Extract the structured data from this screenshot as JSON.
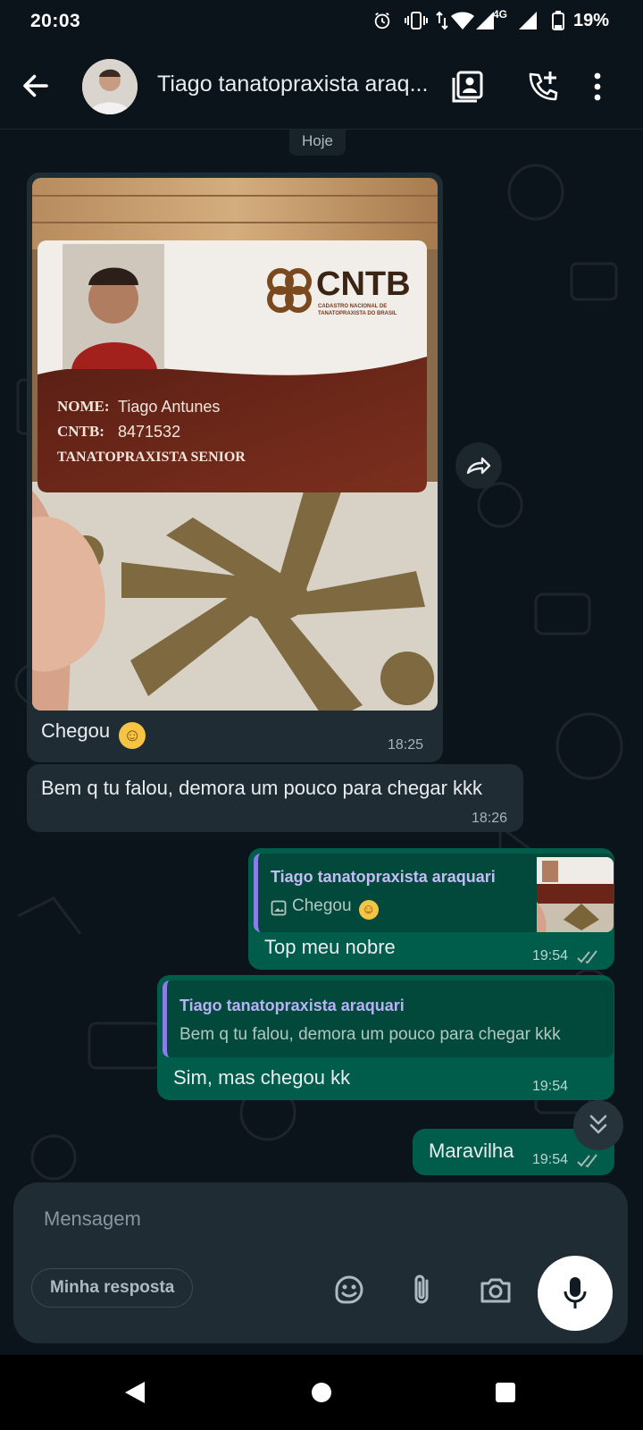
{
  "status_bar": {
    "time": "20:03",
    "network": "4G",
    "battery": "19%",
    "icons": [
      "alarm-icon",
      "vibrate-icon",
      "data-arrows-icon",
      "wifi-icon",
      "signal-icon",
      "signal-icon",
      "battery-icon"
    ]
  },
  "header": {
    "contact_name": "Tiago tanatopraxista araq...",
    "actions": [
      "contact-card-icon",
      "add-call-icon",
      "more-icon"
    ]
  },
  "chat": {
    "date_label": "Hoje",
    "card_photo": {
      "brand": "CNTB",
      "brand_sub": "CADASTRO NACIONAL DE TANATOPRAXISTA DO BRASIL",
      "name_label": "NOME:",
      "name_value": "Tiago Antunes",
      "id_label": "CNTB:",
      "id_value": "8471532",
      "role": "TANATOPRAXISTA SENIOR"
    },
    "messages": [
      {
        "direction": "in",
        "text": "Chegou",
        "emoji": "☺",
        "time": "18:25",
        "has_image": true
      },
      {
        "direction": "in",
        "text": "Bem q tu falou, demora um pouco para chegar kkk",
        "time": "18:26"
      },
      {
        "direction": "out",
        "quote_author": "Tiago tanatopraxista araquari",
        "quote_text": "Chegou",
        "quote_emoji": "☺",
        "text": "Top meu nobre",
        "time": "19:54"
      },
      {
        "direction": "out",
        "quote_author": "Tiago tanatopraxista araquari",
        "quote_text": "Bem q tu falou, demora um pouco para chegar kkk",
        "text": "Sim, mas chegou kk",
        "time": "19:54"
      },
      {
        "direction": "out",
        "text": "Maravilha",
        "time": "19:54"
      }
    ]
  },
  "composer": {
    "placeholder": "Mensagem",
    "chip_label": "Minha resposta"
  },
  "colors": {
    "background": "#0b141a",
    "bubble_in": "#202c33",
    "bubble_out": "#005c4b",
    "quote_bar": "#8b7de8",
    "read_ticks": "#a8b8b3"
  }
}
